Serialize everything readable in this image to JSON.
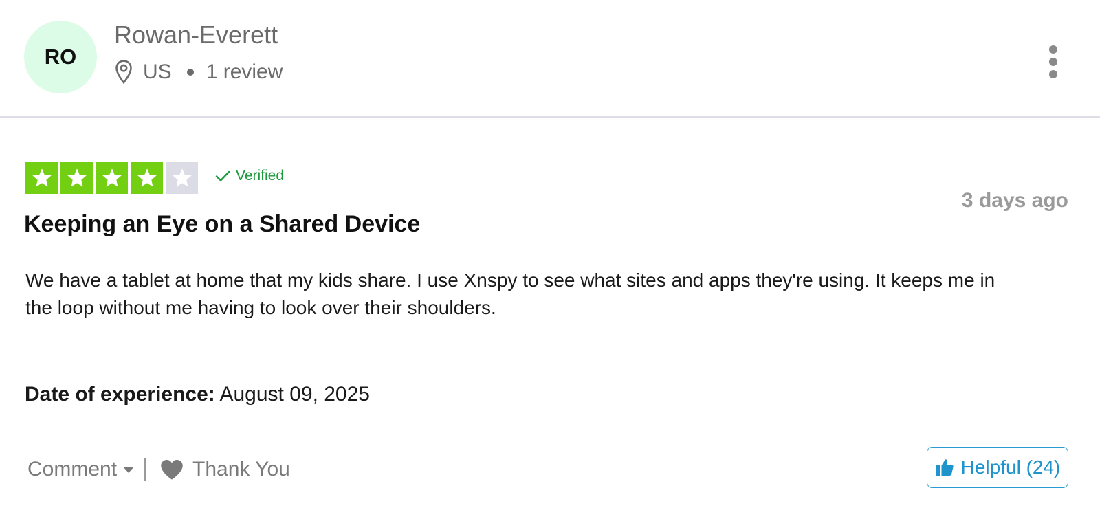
{
  "reviewer": {
    "initials": "RO",
    "name": "Rowan-Everett",
    "country": "US",
    "review_count": "1 review",
    "avatar_color": "#dcfce7"
  },
  "review": {
    "rating": 4,
    "rating_max": 5,
    "star_color": "#73cf11",
    "star_empty_color": "#dcdce6",
    "verified_label": "Verified",
    "age": "3 days ago",
    "title": "Keeping an Eye on a Shared Device",
    "body": "We have a tablet at home that my kids share. I use Xnspy to see what  sites and apps they're using. It keeps me in the loop without me having to look over their shoulders.",
    "date_label": "Date of experience:",
    "date_value": "August 09, 2025"
  },
  "actions": {
    "comment_label": "Comment",
    "thank_label": "Thank You",
    "helpful_label": "Helpful (24)",
    "helpful_color": "#1f93cc"
  },
  "icons": {
    "location": "location-pin-icon",
    "more": "more-vertical-icon",
    "verified": "check-icon",
    "comment_dropdown": "caret-down-icon",
    "thank": "heart-icon",
    "helpful": "thumbs-up-icon"
  }
}
